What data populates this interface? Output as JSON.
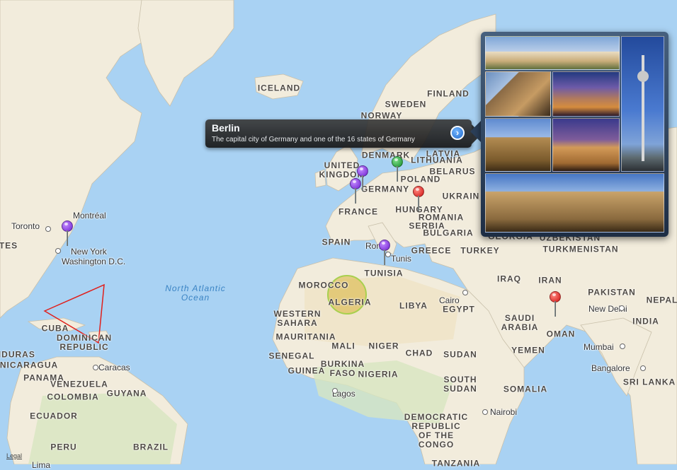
{
  "map": {
    "ocean_labels": [
      {
        "id": "north-atlantic",
        "text": "North Atlantic\nOcean"
      }
    ],
    "country_labels": [
      {
        "text": "ICELAND"
      },
      {
        "text": "FINLAND"
      },
      {
        "text": "SWEDEN"
      },
      {
        "text": "NORWAY"
      },
      {
        "text": "DENMARK"
      },
      {
        "text": "LATVIA"
      },
      {
        "text": "LITHUANIA"
      },
      {
        "text": "BELARUS"
      },
      {
        "text": "UNITED\nKINGDOM"
      },
      {
        "text": "POLAND"
      },
      {
        "text": "GERMANY"
      },
      {
        "text": "UKRAIN"
      },
      {
        "text": "HUNGARY"
      },
      {
        "text": "ROMANIA"
      },
      {
        "text": "FRANCE"
      },
      {
        "text": "SERBIA"
      },
      {
        "text": "BULGARIA"
      },
      {
        "text": "SPAIN"
      },
      {
        "text": "GREECE"
      },
      {
        "text": "TURKEY"
      },
      {
        "text": "GEORGIA"
      },
      {
        "text": "UZBEKISTAN"
      },
      {
        "text": "TURKMENISTAN"
      },
      {
        "text": "TUNISIA"
      },
      {
        "text": "MOROCCO"
      },
      {
        "text": "ALGERIA"
      },
      {
        "text": "LIBYA"
      },
      {
        "text": "EGYPT"
      },
      {
        "text": "IRAQ"
      },
      {
        "text": "IRAN"
      },
      {
        "text": "PAKISTAN"
      },
      {
        "text": "NEPAL"
      },
      {
        "text": "INDIA"
      },
      {
        "text": "SAUDI\nARABIA"
      },
      {
        "text": "OMAN"
      },
      {
        "text": "YEMEN"
      },
      {
        "text": "WESTERN\nSAHARA"
      },
      {
        "text": "MAURITANIA"
      },
      {
        "text": "MALI"
      },
      {
        "text": "NIGER"
      },
      {
        "text": "CHAD"
      },
      {
        "text": "SUDAN"
      },
      {
        "text": "SENEGAL"
      },
      {
        "text": "BURKINA\nFASO"
      },
      {
        "text": "GUINEA"
      },
      {
        "text": "NIGERIA"
      },
      {
        "text": "SOUTH\nSUDAN"
      },
      {
        "text": "SOMALIA"
      },
      {
        "text": "DEMOCRATIC\nREPUBLIC\nOF THE\nCONGO"
      },
      {
        "text": "TES"
      },
      {
        "text": "CUBA"
      },
      {
        "text": "DOMINICAN\nREPUBLIC"
      },
      {
        "text": "ONDURAS"
      },
      {
        "text": "NICARAGUA"
      },
      {
        "text": "PANAMA"
      },
      {
        "text": "VENEZUELA"
      },
      {
        "text": "GUYANA"
      },
      {
        "text": "COLOMBIA"
      },
      {
        "text": "ECUADOR"
      },
      {
        "text": "PERU"
      },
      {
        "text": "BRAZIL"
      },
      {
        "text": "SRI LANKA"
      },
      {
        "text": "TANZANIA"
      }
    ],
    "city_labels": [
      {
        "text": "Montréal"
      },
      {
        "text": "Toronto"
      },
      {
        "text": "New York"
      },
      {
        "text": "Washington D.C."
      },
      {
        "text": "Rome"
      },
      {
        "text": "Tunis"
      },
      {
        "text": "Cairo"
      },
      {
        "text": "New Delhi"
      },
      {
        "text": "Mumbai"
      },
      {
        "text": "Bangalore"
      },
      {
        "text": "Nairobi"
      },
      {
        "text": "Lagos"
      },
      {
        "text": "Caracas"
      },
      {
        "text": "Lima"
      }
    ],
    "pins": [
      {
        "name": "pin-new-york",
        "color": "purple"
      },
      {
        "name": "pin-uk",
        "color": "purple"
      },
      {
        "name": "pin-netherlands",
        "color": "purple"
      },
      {
        "name": "pin-berlin",
        "color": "green"
      },
      {
        "name": "pin-hungary",
        "color": "red"
      },
      {
        "name": "pin-rome",
        "color": "purple"
      },
      {
        "name": "pin-gulf",
        "color": "red"
      }
    ],
    "overlays": {
      "triangle_color": "#e0201c",
      "circle_color": "#d9b43a"
    },
    "legal_link": "Legal"
  },
  "callout": {
    "title": "Berlin",
    "subtitle": "The capital city of Germany and one of the 16 states of Germany",
    "detail_icon": "chevron-right-icon"
  },
  "popover": {
    "photos": [
      {
        "name": "photo-charlottenburg-palace"
      },
      {
        "name": "photo-altes-museum"
      },
      {
        "name": "photo-potsdamer-platz"
      },
      {
        "name": "photo-berlin-cathedral"
      },
      {
        "name": "photo-brandenburg-gate"
      },
      {
        "name": "photo-tv-tower"
      },
      {
        "name": "photo-reichstag"
      }
    ]
  }
}
